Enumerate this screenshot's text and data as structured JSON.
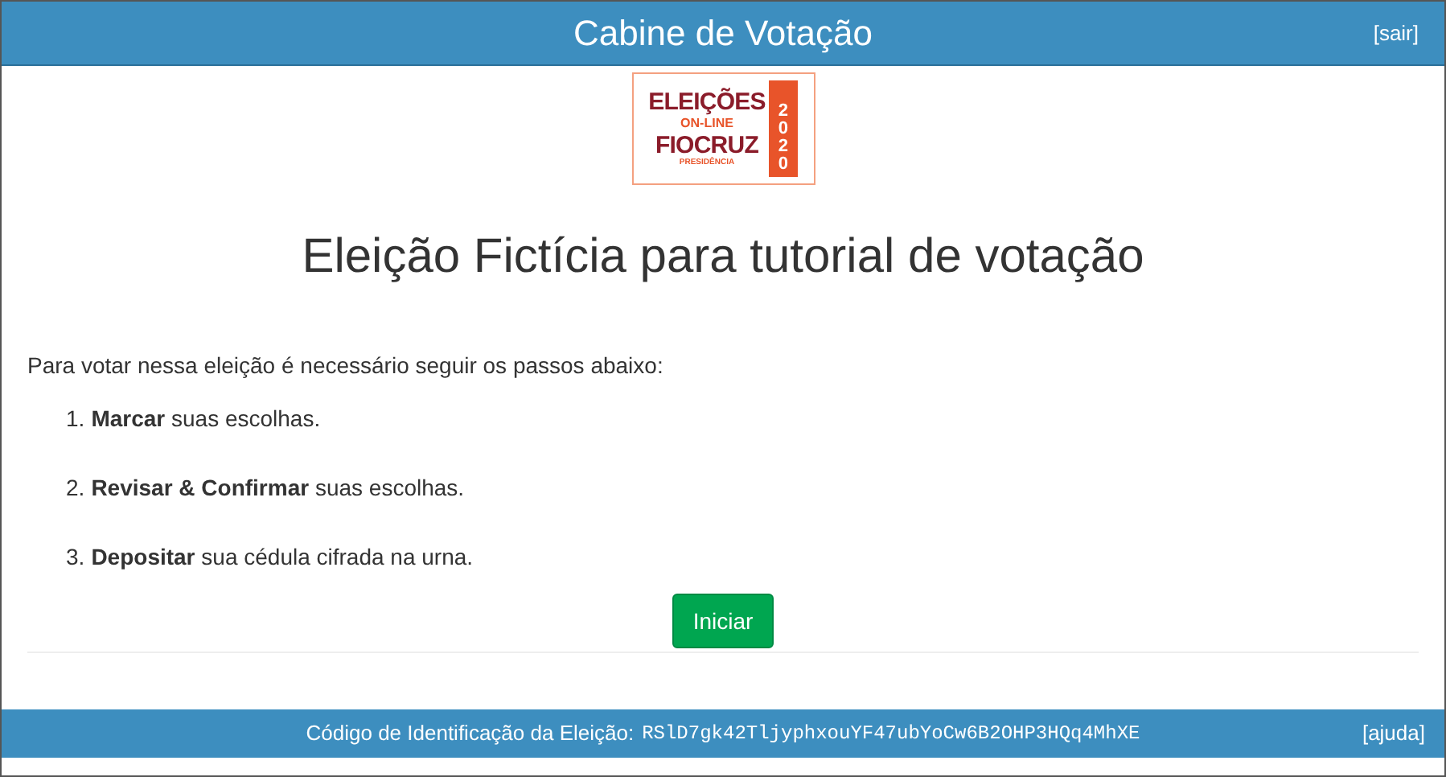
{
  "header": {
    "title": "Cabine de Votação",
    "logout_link": "[sair]"
  },
  "logo": {
    "line_1": "ELEIÇÕES",
    "line_2": "ON-LINE",
    "line_3": "FIOCRUZ",
    "year": "2020",
    "subtitle": "PRESIDÊNCIA"
  },
  "election_title": "Eleição Fictícia para tutorial de votação",
  "intro": "Para votar nessa eleição é necessário seguir os passos abaixo:",
  "steps": [
    {
      "number": "1.",
      "text": "**Marcar** suas escolhas."
    },
    {
      "number": "2.",
      "text": "**Revisar & Confirmar** suas escolhas."
    },
    {
      "number": "3.",
      "text": "**Depositar** sua cédula cifrada na urna."
    }
  ],
  "start_button": "Iniciar",
  "footer": {
    "label": "Código de Identificação da Eleição:",
    "code": "RSlD7gk42TljyphxouYF47ubYoCw6B2OHP3HQq4MhXE",
    "help_link": "[ajuda]"
  }
}
